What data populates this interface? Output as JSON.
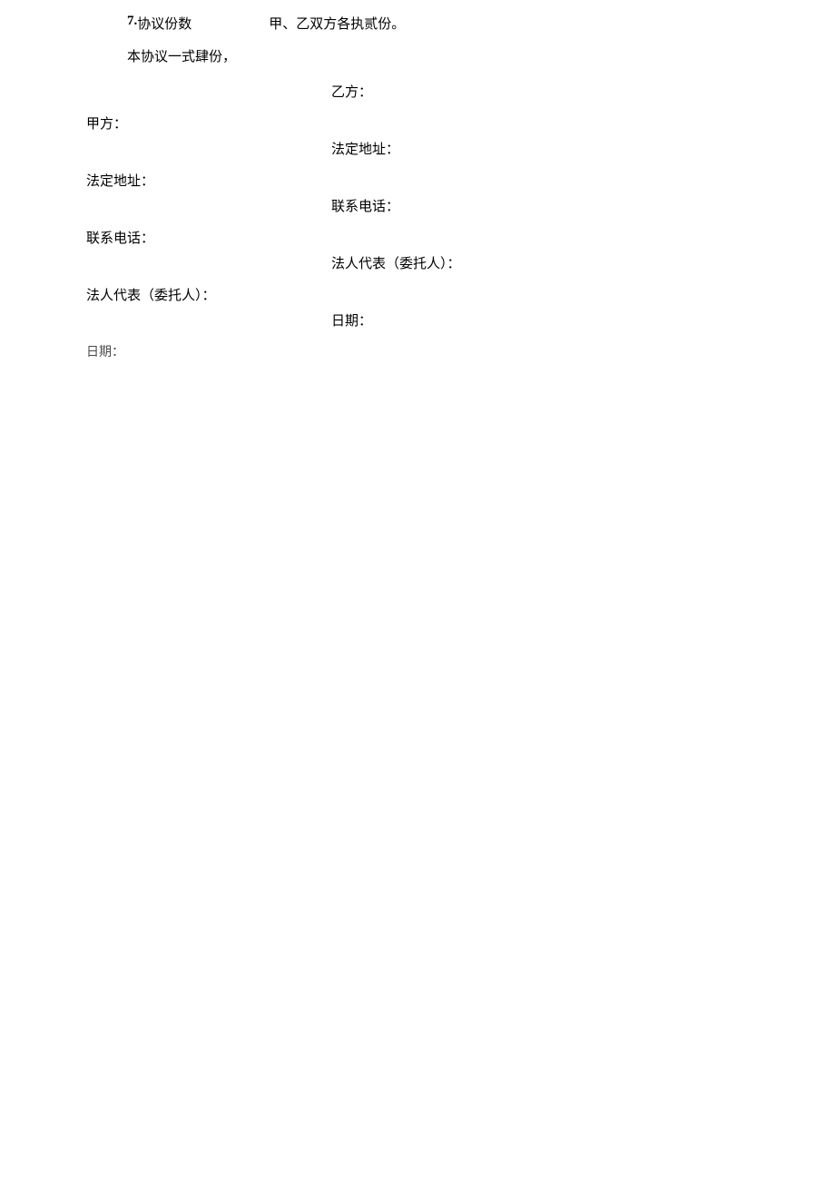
{
  "section": {
    "number": "7.",
    "title": "协议份数",
    "note": "甲、乙双方各执贰份。"
  },
  "statement": "本协议一式肆份，",
  "partyA": {
    "name": "甲方：",
    "address": "法定地址：",
    "phone": "联系电话：",
    "representative": "法人代表（委托人）：",
    "date": "日期："
  },
  "partyB": {
    "name": "乙方：",
    "address": "法定地址：",
    "phone": "联系电话：",
    "representative": "法人代表（委托人）：",
    "date": "日期："
  }
}
